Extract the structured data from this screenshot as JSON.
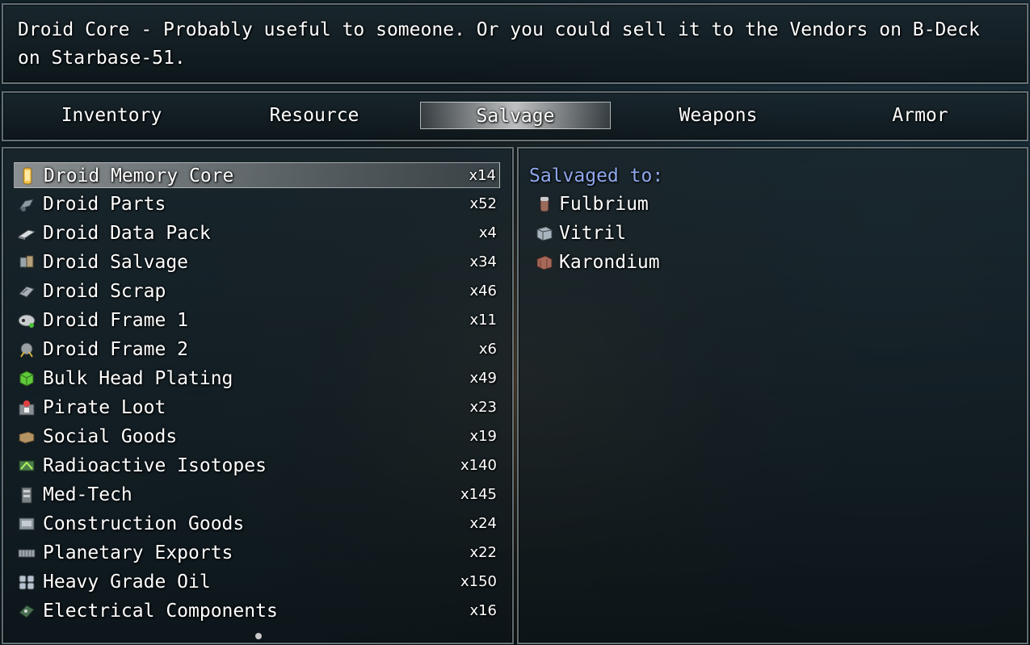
{
  "help": {
    "text": "Droid Core - Probably useful to someone. Or you could sell it to the Vendors on B-Deck on Starbase-51."
  },
  "tabs": [
    {
      "label": "Inventory",
      "selected": false
    },
    {
      "label": "Resource",
      "selected": false
    },
    {
      "label": "Salvage",
      "selected": true
    },
    {
      "label": "Weapons",
      "selected": false
    },
    {
      "label": "Armor",
      "selected": false
    }
  ],
  "items": [
    {
      "name": "Droid Memory Core",
      "qty": "x14",
      "icon": "memory-core-icon",
      "selected": true
    },
    {
      "name": "Droid Parts",
      "qty": "x52",
      "icon": "droid-parts-icon"
    },
    {
      "name": "Droid Data Pack",
      "qty": "x4",
      "icon": "data-pack-icon"
    },
    {
      "name": "Droid Salvage",
      "qty": "x34",
      "icon": "droid-salvage-icon"
    },
    {
      "name": "Droid Scrap",
      "qty": "x46",
      "icon": "droid-scrap-icon"
    },
    {
      "name": "Droid Frame 1",
      "qty": "x11",
      "icon": "droid-frame-icon"
    },
    {
      "name": "Droid Frame 2",
      "qty": "x6",
      "icon": "droid-frame-2-icon"
    },
    {
      "name": "Bulk Head Plating",
      "qty": "x49",
      "icon": "green-cube-icon"
    },
    {
      "name": "Pirate Loot",
      "qty": "x23",
      "icon": "pirate-loot-icon"
    },
    {
      "name": "Social Goods",
      "qty": "x19",
      "icon": "crate-icon"
    },
    {
      "name": "Radioactive Isotopes",
      "qty": "x140",
      "icon": "isotope-icon"
    },
    {
      "name": "Med-Tech",
      "qty": "x145",
      "icon": "med-tech-icon"
    },
    {
      "name": "Construction Goods",
      "qty": "x24",
      "icon": "construction-icon"
    },
    {
      "name": "Planetary Exports",
      "qty": "x22",
      "icon": "container-icon"
    },
    {
      "name": "Heavy Grade Oil",
      "qty": "x150",
      "icon": "oil-barrels-icon"
    },
    {
      "name": "Electrical Components",
      "qty": "x16",
      "icon": "circuit-board-icon"
    }
  ],
  "detail": {
    "header": "Salvaged to:",
    "results": [
      {
        "name": "Fulbrium",
        "icon": "canister-icon"
      },
      {
        "name": "Vitril",
        "icon": "vitril-icon"
      },
      {
        "name": "Karondium",
        "icon": "karondium-crate-icon"
      }
    ]
  },
  "colors": {
    "header_text": "#8fa8ee",
    "text": "#ffffff",
    "window_border": "#a5b4b9"
  }
}
